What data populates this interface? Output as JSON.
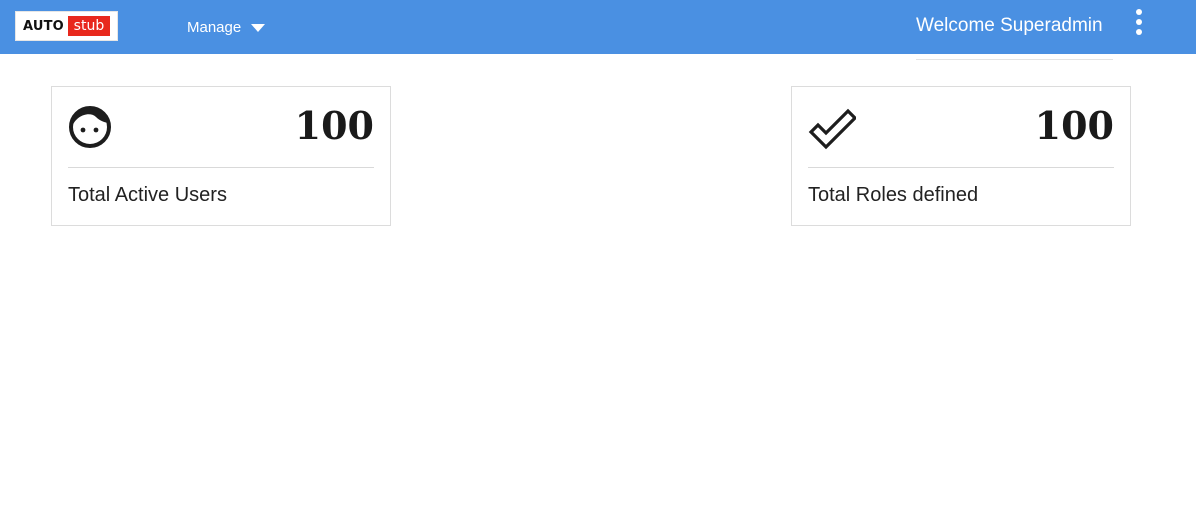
{
  "header": {
    "logo": {
      "part1": "AUTO",
      "part2": "stub",
      "part1_color": "#111111",
      "part2_bg": "#e8281d"
    },
    "nav": {
      "manage_label": "Manage",
      "manage_icon": "caret-down-icon"
    },
    "welcome_text": "Welcome Superadmin",
    "menu_icon": "kebab-menu-icon",
    "background_color": "#4a90e2"
  },
  "cards": [
    {
      "icon": "face-icon",
      "value": "100",
      "label": "Total Active Users"
    },
    {
      "icon": "double-check-icon",
      "value": "100",
      "label": "Total Roles defined"
    }
  ]
}
